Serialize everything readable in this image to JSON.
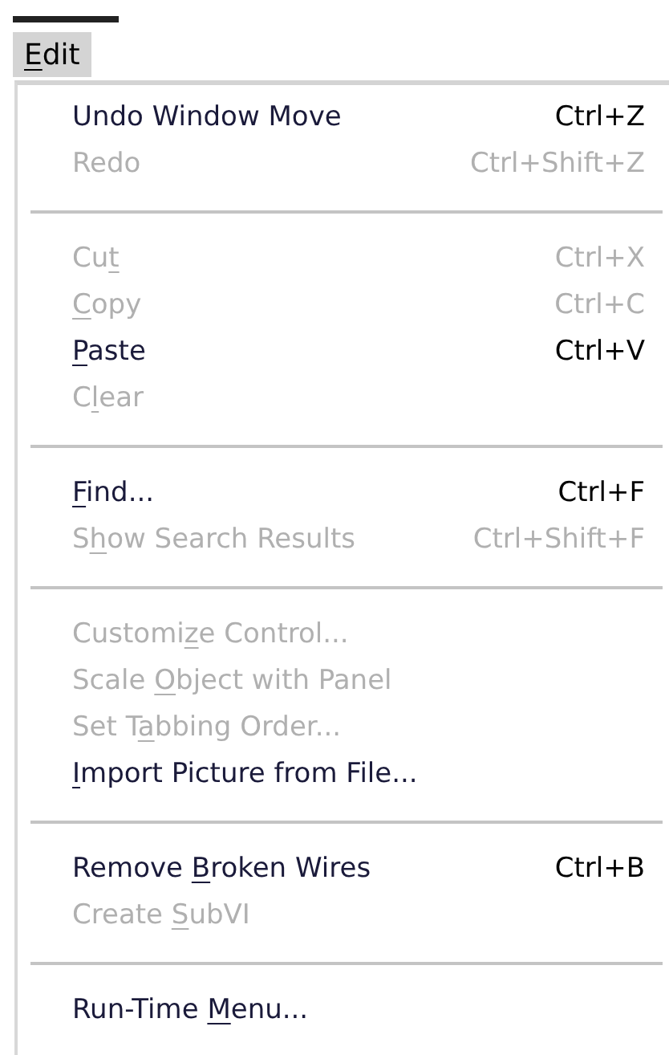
{
  "menu_bar": {
    "title": {
      "key": "E",
      "after": "dit"
    },
    "open": true
  },
  "menu": {
    "groups": [
      {
        "items": [
          {
            "label": {
              "before": "Undo Window Move"
            },
            "shortcut": "Ctrl+Z",
            "disabled": false
          },
          {
            "label": {
              "before": "Redo"
            },
            "shortcut": "Ctrl+Shift+Z",
            "disabled": true
          }
        ]
      },
      {
        "items": [
          {
            "label": {
              "before": "Cu",
              "key": "t"
            },
            "shortcut": "Ctrl+X",
            "disabled": true
          },
          {
            "label": {
              "key": "C",
              "after": "opy"
            },
            "shortcut": "Ctrl+C",
            "disabled": true
          },
          {
            "label": {
              "key": "P",
              "after": "aste"
            },
            "shortcut": "Ctrl+V",
            "disabled": false
          },
          {
            "label": {
              "before": "C",
              "key": "l",
              "after": "ear"
            },
            "disabled": true
          }
        ]
      },
      {
        "items": [
          {
            "label": {
              "key": "F",
              "after": "ind..."
            },
            "shortcut": "Ctrl+F",
            "disabled": false
          },
          {
            "label": {
              "before": "S",
              "key": "h",
              "after": "ow Search Results"
            },
            "shortcut": "Ctrl+Shift+F",
            "disabled": true
          }
        ]
      },
      {
        "items": [
          {
            "label": {
              "before": "Customi",
              "key": "z",
              "after": "e Control..."
            },
            "disabled": true
          },
          {
            "label": {
              "before": "Scale ",
              "key": "O",
              "after": "bject with Panel"
            },
            "disabled": true
          },
          {
            "label": {
              "before": "Set T",
              "key": "a",
              "after": "bbing Order..."
            },
            "disabled": true
          },
          {
            "label": {
              "key": "I",
              "after": "mport Picture from File..."
            },
            "disabled": false
          }
        ]
      },
      {
        "items": [
          {
            "label": {
              "before": "Remove ",
              "key": "B",
              "after": "roken Wires"
            },
            "shortcut": "Ctrl+B",
            "disabled": false
          },
          {
            "label": {
              "before": "Create ",
              "key": "S",
              "after": "ubVI"
            },
            "disabled": true
          }
        ]
      },
      {
        "items": [
          {
            "label": {
              "before": "Run-Time ",
              "key": "M",
              "after": "enu..."
            },
            "disabled": false
          }
        ]
      }
    ]
  }
}
